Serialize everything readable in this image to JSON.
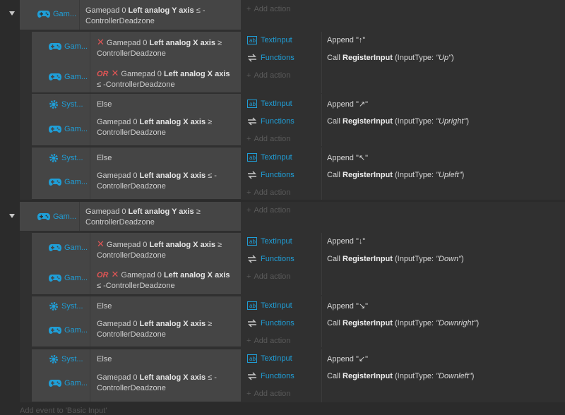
{
  "block_labels": {
    "gamepad": "Gam...",
    "system": "Syst..."
  },
  "common": {
    "gamepad_0": "Gamepad 0",
    "left_y": "Left analog Y axis",
    "left_x": "Left analog X axis",
    "le_minus": "≤ -",
    "le_minus_x": "≤ -ControllerDeadzone",
    "ge": "≥",
    "deadzone": "ControllerDeadzone",
    "or": "OR",
    "else": "Else",
    "text_input": "TextInput",
    "functions": "Functions",
    "add_action": "Add action",
    "append": "Append",
    "call": "Call",
    "register_input": "RegisterInput",
    "input_type_label": "(InputType:"
  },
  "groups": [
    {
      "parent": {
        "op": "≤ -",
        "suffix": "ControllerDeadzone"
      },
      "subs": [
        {
          "kind": "or",
          "append": "\"↑\"",
          "type": "\"Up\""
        },
        {
          "kind": "else_ge",
          "append": "\"↗\"",
          "type": "\"Upright\""
        },
        {
          "kind": "else_le",
          "append": "\"↖\"",
          "type": "\"Upleft\""
        }
      ]
    },
    {
      "parent": {
        "op": "≥",
        "suffix": "ControllerDeadzone"
      },
      "subs": [
        {
          "kind": "or",
          "append": "\"↓\"",
          "type": "\"Down\""
        },
        {
          "kind": "else_ge",
          "append": "\"↘\"",
          "type": "\"Downright\""
        },
        {
          "kind": "else_le",
          "append": "\"↙\"",
          "type": "\"Downleft\""
        }
      ]
    }
  ],
  "footer": "Add event to 'Basic Input'",
  "colors": {
    "accent": "#1f9fd8",
    "invert": "#e05555"
  }
}
